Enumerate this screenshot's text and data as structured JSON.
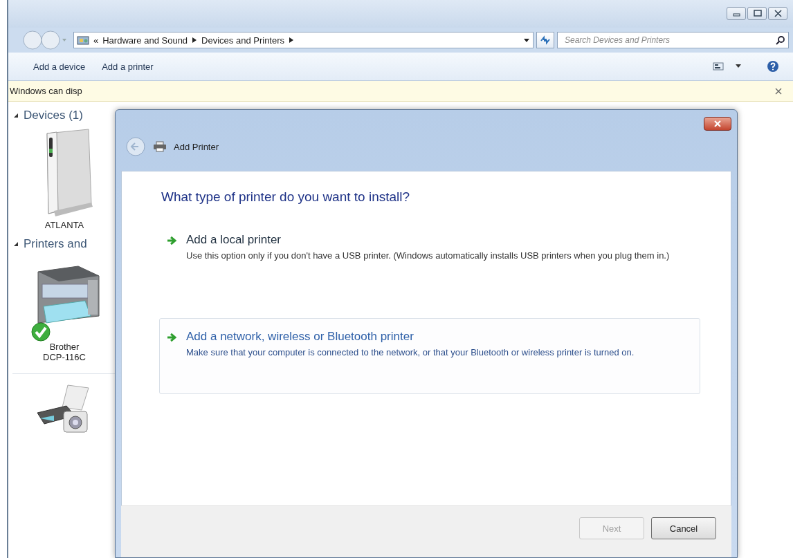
{
  "address_bar": {
    "overflow": "«",
    "breadcrumbs": [
      "Hardware and Sound",
      "Devices and Printers"
    ]
  },
  "search": {
    "placeholder": "Search Devices and Printers"
  },
  "toolbar": {
    "buttons": [
      "Add a device",
      "Add a printer"
    ]
  },
  "info_bar": {
    "text": "Windows can disp"
  },
  "groups": [
    {
      "label": "Devices (1)",
      "expanded": true,
      "items": [
        {
          "label": "ATLANTA",
          "kind": "drive"
        }
      ]
    },
    {
      "label": "Printers and",
      "expanded": true,
      "items": [
        {
          "label": "Brother DCP-116C",
          "kind": "printer",
          "default": true
        }
      ]
    },
    {
      "items": [
        {
          "kind": "multifunction"
        }
      ]
    }
  ],
  "dialog": {
    "title": "Add Printer",
    "heading": "What type of printer do you want to install?",
    "options": [
      {
        "title": "Add a local printer",
        "description": "Use this option only if you don't have a USB printer. (Windows automatically installs USB printers when you plug them in.)",
        "highlighted": false
      },
      {
        "title": "Add a network, wireless or Bluetooth printer",
        "description": "Make sure that your computer is connected to the network, or that your Bluetooth or wireless printer is turned on.",
        "highlighted": true
      }
    ],
    "buttons": [
      {
        "label": "Next",
        "disabled": true
      },
      {
        "label": "Cancel",
        "disabled": false
      }
    ]
  }
}
